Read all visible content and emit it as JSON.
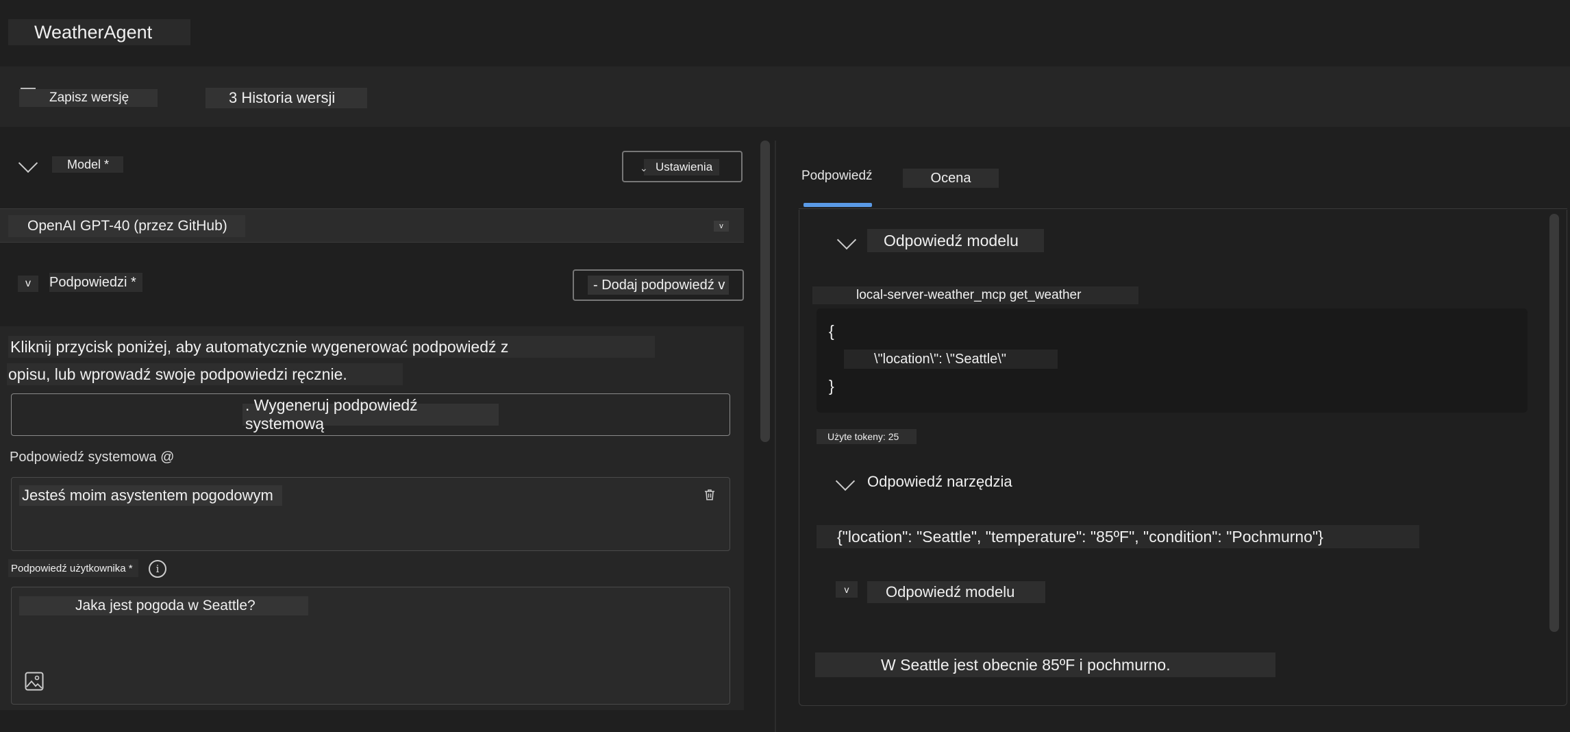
{
  "app": {
    "title": "WeatherAgent"
  },
  "toolbar": {
    "save_label": "Zapisz wersję",
    "history_label": "3 Historia wersji"
  },
  "model_section": {
    "label": "Model *",
    "settings_label": "Ustawienia",
    "selected_model": "OpenAI GPT-40 (przez GitHub)",
    "select_arrow": "v"
  },
  "prompts_section": {
    "toggle": "v",
    "label": "Podpowiedzi *",
    "add_prompt_label": "- Dodaj podpowiedź v",
    "hint_line1": "Kliknij przycisk poniżej, aby automatycznie wygenerować podpowiedź z",
    "hint_line2": "opisu, lub wprowadź swoje podpowiedzi ręcznie.",
    "generate_label": ". Wygeneruj podpowiedź systemową",
    "system_prompt_label": "Podpowiedź systemowa @",
    "system_prompt_value": "Jesteś moim asystentem pogodowym",
    "user_prompt_label": "Podpowiedź użytkownika *",
    "user_prompt_value": "Jaka jest pogoda w Seattle?",
    "info_glyph": "i"
  },
  "tabs": [
    {
      "label": "Podpowiedź",
      "active": true
    },
    {
      "label": "Ocena",
      "active": false
    }
  ],
  "output": {
    "model_response_label": "Odpowiedź modelu",
    "tool_call_name": "local-server-weather_mcp get_weather",
    "code_open": "{",
    "code_line": "\\\"location\\\": \\\"Seattle\\\"",
    "code_close": "}",
    "tokens_label": "Użyte tokeny: 25",
    "tool_response_label": "Odpowiedź narzędzia",
    "tool_response_text": "{\"location\": \"Seattle\", \"temperature\": \"85ºF\", \"condition\": \"Pochmurno\"}",
    "model_response2_toggle": "v",
    "model_response2_label": "Odpowiedź modelu",
    "final_response": "W Seattle jest obecnie 85ºF i pochmurno."
  },
  "colors": {
    "background": "#1f1f1f",
    "accent": "#5a9ae6",
    "panel": "#262626"
  }
}
